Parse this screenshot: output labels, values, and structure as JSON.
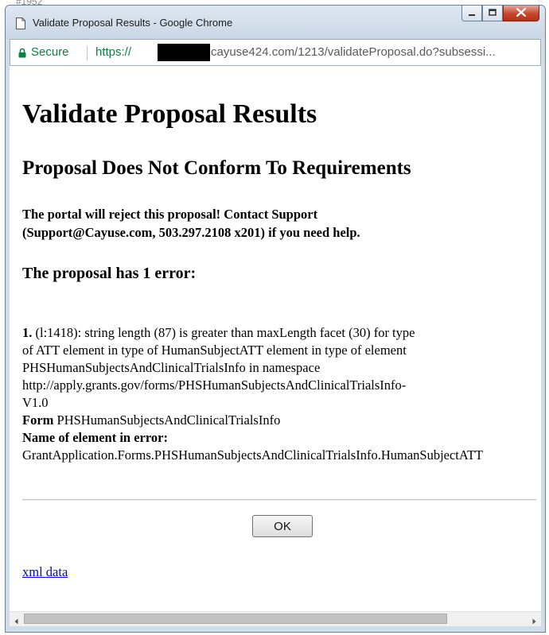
{
  "background": {
    "fragment": "#1952"
  },
  "window": {
    "title": "Validate Proposal Results - Google Chrome",
    "buttons": {
      "minimize": "minimize",
      "maximize": "maximize",
      "close": "close"
    }
  },
  "address_bar": {
    "secure_label": "Secure",
    "url_prefix": "https://",
    "url_rest": "cayuse424.com/1213/validateProposal.do?subsessi..."
  },
  "page": {
    "title": "Validate Proposal Results",
    "subtitle": "Proposal Does Not Conform To Requirements",
    "warning_line1": "The portal will reject this proposal! Contact Support",
    "warning_line2": "(Support@Cayuse.com, 503.297.2108 x201) if you need help.",
    "error_count": "The proposal has 1 error:",
    "error": {
      "number": "1.",
      "lines": [
        " (l:1418): string length (87) is greater than maxLength facet (30) for type",
        "of ATT element in type of HumanSubjectATT element in type of element",
        "PHSHumanSubjectsAndClinicalTrialsInfo in namespace",
        "http://apply.grants.gov/forms/PHSHumanSubjectsAndClinicalTrialsInfo-",
        "V1.0"
      ],
      "form_label": "Form",
      "form_value": " PHSHumanSubjectsAndClinicalTrialsInfo",
      "element_label": "Name of element in error:",
      "element_value": "GrantApplication.Forms.PHSHumanSubjectsAndClinicalTrialsInfo.HumanSubjectATT"
    },
    "ok_button": "OK",
    "xml_link": "xml data"
  },
  "colors": {
    "secure_green": "#0b8043",
    "link_blue": "#0000ee",
    "close_red": "#c7452c"
  },
  "icons": [
    "page-icon",
    "lock-icon",
    "minimize-icon",
    "maximize-icon",
    "close-icon",
    "scroll-left-icon",
    "scroll-right-icon"
  ]
}
